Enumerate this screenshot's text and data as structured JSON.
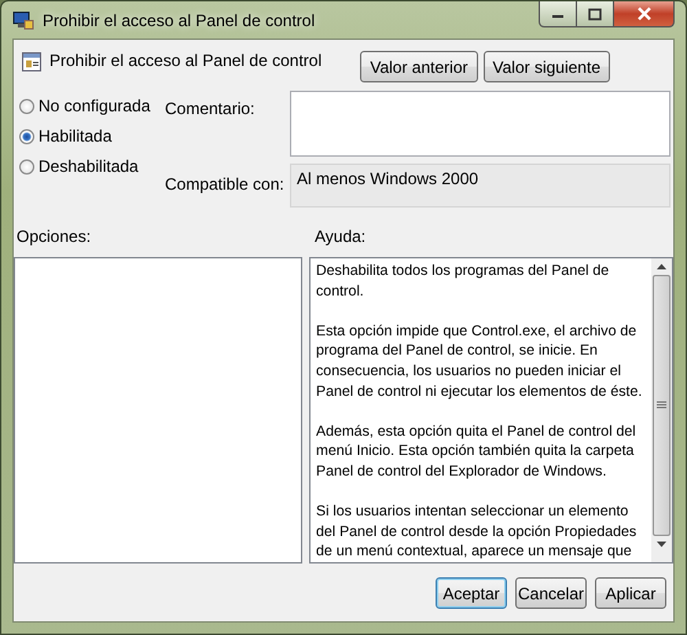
{
  "window": {
    "title": "Prohibir el acceso al Panel de control"
  },
  "setting": {
    "name": "Prohibir el acceso al Panel de control"
  },
  "nav_buttons": [
    "Valor anterior",
    "Valor siguiente"
  ],
  "state_options": [
    {
      "label": "No configurada",
      "selected": false
    },
    {
      "label": "Habilitada",
      "selected": true
    },
    {
      "label": "Deshabilitada",
      "selected": false
    }
  ],
  "comment": {
    "label": "Comentario:"
  },
  "compatible": {
    "label": "Compatible con:",
    "value": "Al menos Windows 2000"
  },
  "options": {
    "label": "Opciones:"
  },
  "help": {
    "label": "Ayuda:",
    "paragraphs": [
      [
        "Deshabilita todos los programas del Panel de",
        "control."
      ],
      [
        "Esta opción impide que Control.exe, el archivo de",
        "programa del Panel de control, se inicie. En",
        "consecuencia, los usuarios no pueden iniciar el",
        "Panel de control ni ejecutar los elementos de éste."
      ],
      [
        "Además, esta opción quita el Panel de control del",
        "menú Inicio. Esta opción también quita la carpeta",
        "Panel de control del Explorador de Windows."
      ],
      [
        "Si los usuarios intentan seleccionar un elemento",
        "del Panel de control desde la opción Propiedades",
        "de un menú contextual, aparece un mensaje que"
      ]
    ]
  },
  "buttons": [
    {
      "label": "Aceptar",
      "selected": true
    },
    {
      "label": "Cancelar",
      "selected": false
    },
    {
      "label": "Aplicar",
      "selected": false
    }
  ]
}
